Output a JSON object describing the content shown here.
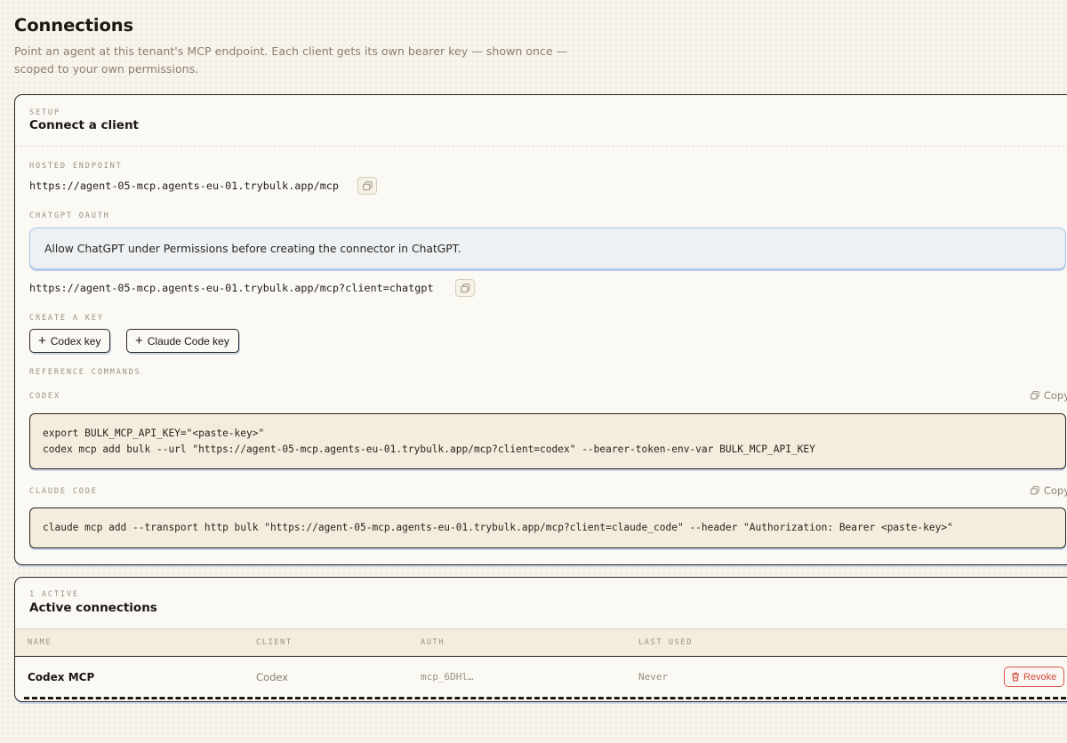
{
  "page": {
    "title": "Connections",
    "subtitle": "Point an agent at this tenant's MCP endpoint. Each client gets its own bearer key — shown once — scoped to your own permissions."
  },
  "setup": {
    "eyebrow": "SETUP",
    "title": "Connect a client",
    "hosted_endpoint": {
      "label": "HOSTED ENDPOINT",
      "url": "https://agent-05-mcp.agents-eu-01.trybulk.app/mcp"
    },
    "chatgpt_oauth": {
      "label": "CHATGPT OAUTH",
      "notice": "Allow ChatGPT under Permissions before creating the connector in ChatGPT.",
      "url": "https://agent-05-mcp.agents-eu-01.trybulk.app/mcp?client=chatgpt"
    },
    "create_key": {
      "label": "CREATE A KEY",
      "buttons": [
        "Codex key",
        "Claude Code key"
      ]
    },
    "reference_commands": {
      "label": "REFERENCE COMMANDS",
      "copy_label": "Copy",
      "codex": {
        "label": "CODEX",
        "lines": [
          "export BULK_MCP_API_KEY=\"<paste-key>\"",
          "codex mcp add bulk --url \"https://agent-05-mcp.agents-eu-01.trybulk.app/mcp?client=codex\" --bearer-token-env-var BULK_MCP_API_KEY"
        ]
      },
      "claude_code": {
        "label": "CLAUDE CODE",
        "lines": [
          "claude mcp add --transport http bulk \"https://agent-05-mcp.agents-eu-01.trybulk.app/mcp?client=claude_code\" --header \"Authorization: Bearer <paste-key>\""
        ]
      }
    }
  },
  "active": {
    "eyebrow": "1 ACTIVE",
    "title": "Active connections",
    "columns": [
      "NAME",
      "CLIENT",
      "AUTH",
      "LAST USED"
    ],
    "rows": [
      {
        "name": "Codex MCP",
        "client": "Codex",
        "auth": "mcp_6DHl…",
        "last_used": "Never",
        "action": "Revoke"
      }
    ]
  },
  "icons": {
    "copy": "copy-icon",
    "plus": "plus-icon",
    "trash": "trash-icon"
  },
  "colors": {
    "background": "#f8f4ec",
    "card": "#fbf9f4",
    "code_bg": "#f4ecdd",
    "callout_bg": "#eef1f3",
    "callout_border": "#a9c3e8",
    "danger": "#d04a40",
    "muted": "#9b9183"
  }
}
